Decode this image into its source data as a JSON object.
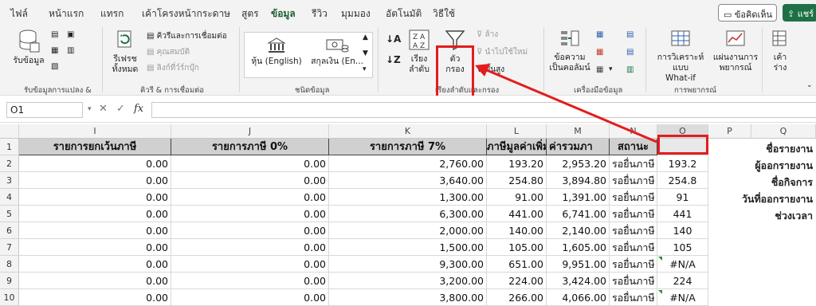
{
  "tabs": [
    "ไฟล์",
    "หน้าแรก",
    "แทรก",
    "เค้าโครงหน้ากระดาษ",
    "สูตร",
    "ข้อมูล",
    "รีวิว",
    "มุมมอง",
    "อัตโนมัติ",
    "วิธีใช้"
  ],
  "active_tab": "ข้อมูล",
  "comments_label": "ข้อคิดเห็น",
  "share_label": "แชร์",
  "ribbon": {
    "get_data": "รับข้อมูล",
    "group_get_transform": "รับข้อมูลการแปลง &",
    "refresh_all_line1": "รีเฟรช",
    "refresh_all_line2": "ทั้งหมด",
    "queries_connections": "คิวรีและการเชื่อมต่อ",
    "properties": "คุณสมบัติ",
    "edit_links": "ลิงก์ที่ว์ร์กบุ๊ก",
    "group_queries": "คิวรี & การเชื่อมต่อ",
    "stocks": "หุ้น (English)",
    "currencies": "สกุลเงิน (En...",
    "group_data_types": "ชนิดข้อมูล",
    "sort_line1": "เรียง",
    "sort_line2": "ลำดับ",
    "filter_line1": "ตัว",
    "filter_line2": "กรอง",
    "clear": "ล้าง",
    "reapply": "นำไปใช้ใหม่",
    "advanced": "ขั้นสูง",
    "group_sort_filter": "เรียงลำดับและกรอง",
    "text_to_columns_line1": "ข้อความ",
    "text_to_columns_line2": "เป็นคอลัมน์",
    "group_data_tools": "เครื่องมือข้อมูล",
    "whatif_line1": "การวิเคราะห์แบบ",
    "whatif_line2": "What-if",
    "forecast_line1": "แผ่นงานการ",
    "forecast_line2": "พยากรณ์",
    "group_forecast": "การพยากรณ์",
    "outline_line1": "เค้า",
    "outline_line2": "ร่าง"
  },
  "formula_bar": {
    "name_box": "O1",
    "fx": "fx",
    "value": ""
  },
  "columns": [
    "I",
    "J",
    "K",
    "L",
    "M",
    "N",
    "O",
    "P",
    "Q"
  ],
  "header_row": {
    "I": "รายการยกเว้นภาษี",
    "J": "รายการภาษี 0%",
    "K": "รายการภาษี 7%",
    "L": "ภาษีมูลค่าเพิ่ม",
    "M": "ค่ารวมภา",
    "N": "สถานะ"
  },
  "rows": [
    {
      "n": "2",
      "I": "0.00",
      "J": "0.00",
      "K": "2,760.00",
      "L": "193.20",
      "M": "2,953.20",
      "N": "รอยื่นภาษี",
      "O": "193.2",
      "err": false
    },
    {
      "n": "3",
      "I": "0.00",
      "J": "0.00",
      "K": "3,640.00",
      "L": "254.80",
      "M": "3,894.80",
      "N": "รอยื่นภาษี",
      "O": "254.8",
      "err": false
    },
    {
      "n": "4",
      "I": "0.00",
      "J": "0.00",
      "K": "1,300.00",
      "L": "91.00",
      "M": "1,391.00",
      "N": "รอยื่นภาษี",
      "O": "91",
      "err": false
    },
    {
      "n": "5",
      "I": "0.00",
      "J": "0.00",
      "K": "6,300.00",
      "L": "441.00",
      "M": "6,741.00",
      "N": "รอยื่นภาษี",
      "O": "441",
      "err": false
    },
    {
      "n": "6",
      "I": "0.00",
      "J": "0.00",
      "K": "2,000.00",
      "L": "140.00",
      "M": "2,140.00",
      "N": "รอยื่นภาษี",
      "O": "140",
      "err": false
    },
    {
      "n": "7",
      "I": "0.00",
      "J": "0.00",
      "K": "1,500.00",
      "L": "105.00",
      "M": "1,605.00",
      "N": "รอยื่นภาษี",
      "O": "105",
      "err": false
    },
    {
      "n": "8",
      "I": "0.00",
      "J": "0.00",
      "K": "9,300.00",
      "L": "651.00",
      "M": "9,951.00",
      "N": "รอยื่นภาษี",
      "O": "#N/A",
      "err": true
    },
    {
      "n": "9",
      "I": "0.00",
      "J": "0.00",
      "K": "3,200.00",
      "L": "224.00",
      "M": "3,424.00",
      "N": "รอยื่นภาษี",
      "O": "224",
      "err": false
    },
    {
      "n": "10",
      "I": "0.00",
      "J": "0.00",
      "K": "3,800.00",
      "L": "266.00",
      "M": "4,066.00",
      "N": "รอยื่นภาษี",
      "O": "#N/A",
      "err": true
    }
  ],
  "row1_label": "1",
  "side_labels": [
    "ชื่อรายงาน",
    "ผู้ออกรายงาน",
    "ชื่อกิจการ",
    "วันที่ออกรายงาน",
    "ช่วงเวลา"
  ],
  "colors": {
    "accent": "#1e7145",
    "highlight": "#e31c1c",
    "header_fill": "#d0d0d0"
  }
}
